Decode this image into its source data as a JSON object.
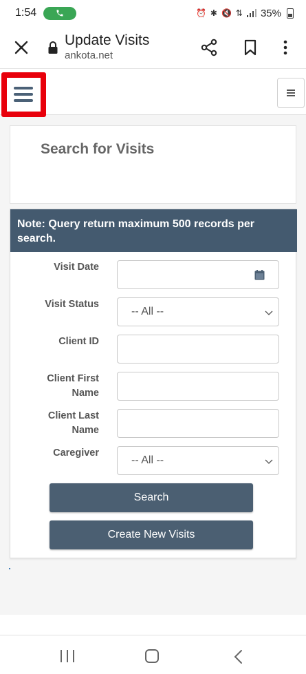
{
  "status_bar": {
    "time": "1:54",
    "battery": "35%",
    "icons": [
      "phone-icon",
      "alarm-icon",
      "bluetooth-icon",
      "mute-icon",
      "wifi-icon",
      "signal-icon",
      "battery-icon"
    ]
  },
  "browser": {
    "title": "Update Visits",
    "url": "ankota.net",
    "icons": [
      "close-icon",
      "lock-icon",
      "share-icon",
      "bookmark-icon",
      "more-vertical-icon"
    ]
  },
  "page": {
    "search_title": "Search for Visits",
    "note": "Note: Query return maximum 500 records per search.",
    "fields": {
      "visit_date": {
        "label": "Visit Date",
        "value": ""
      },
      "visit_status": {
        "label": "Visit Status",
        "selected": "-- All --"
      },
      "client_id": {
        "label": "Client ID",
        "value": ""
      },
      "client_first_name": {
        "label_line1": "Client First",
        "label_line2": "Name",
        "value": ""
      },
      "client_last_name": {
        "label_line1": "Client Last",
        "label_line2": "Name",
        "value": ""
      },
      "caregiver": {
        "label": "Caregiver",
        "selected": "-- All --"
      }
    },
    "buttons": {
      "search": "Search",
      "create": "Create New Visits"
    }
  },
  "colors": {
    "accent": "#445a6f",
    "button": "#4b5f72",
    "highlight": "#e8000b",
    "call_pill": "#3aa655"
  }
}
